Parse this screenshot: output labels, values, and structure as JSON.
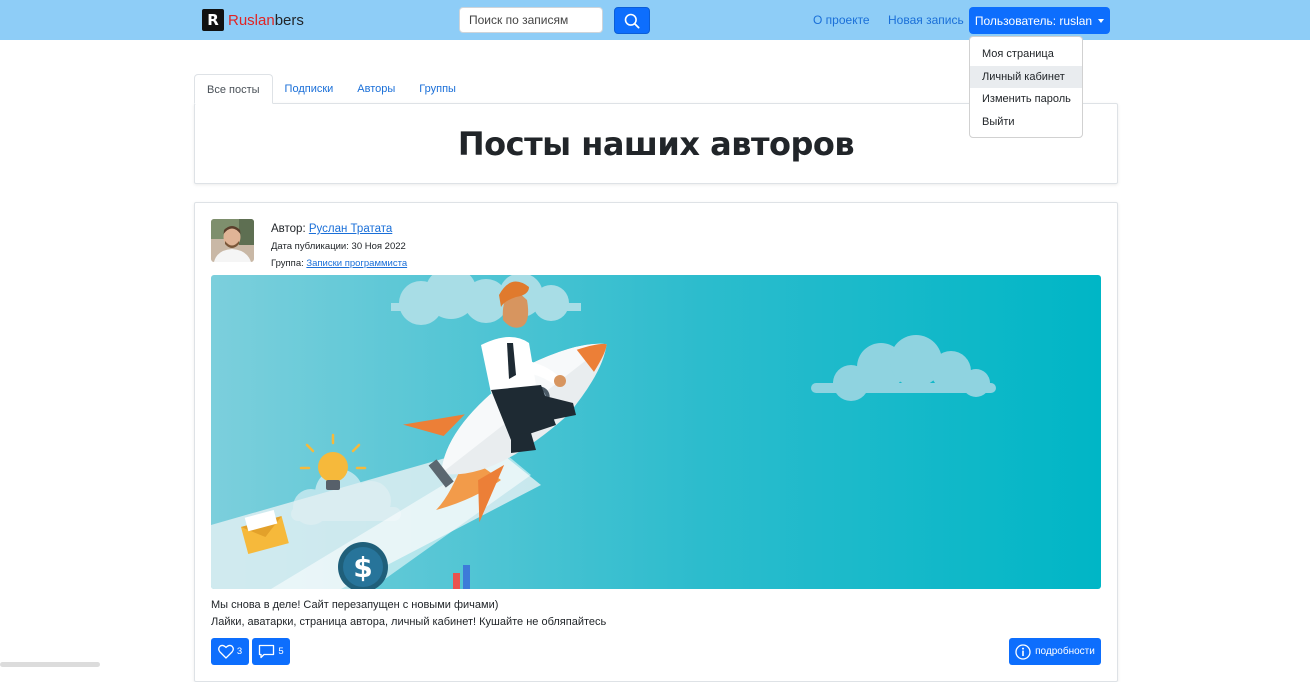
{
  "brand": {
    "logo_letter": "R",
    "name_red": "Ruslan",
    "name_rest": "bers"
  },
  "search": {
    "placeholder": "Поиск по записям",
    "value": ""
  },
  "nav": {
    "about": "О проекте",
    "new_post": "Новая запись",
    "user_button": "Пользователь: ruslan"
  },
  "user_menu": {
    "items": [
      "Моя страница",
      "Личный кабинет",
      "Изменить пароль",
      "Выйти"
    ],
    "highlighted_index": 1
  },
  "tabs": [
    "Все посты",
    "Подписки",
    "Авторы",
    "Группы"
  ],
  "page_title": "Посты наших авторов",
  "post": {
    "author_label": "Автор:",
    "author_name": "Руслан Тратата",
    "date_label": "Дата публикации:",
    "date": "30 Ноя 2022",
    "group_label": "Группа:",
    "group_name": "Записки программиста",
    "text_lines": [
      "Мы снова в деле! Сайт перезапущен с новыми фичами)",
      "Лайки, аватарки, страница автора, личный кабинет! Кушайте не обляпайтесь"
    ],
    "likes": "3",
    "comments": "5",
    "details_label": "подробности"
  },
  "colors": {
    "navbar": "#8ecdf7",
    "primary": "#0d6efd",
    "link": "#1a6fd8",
    "brand_red": "#e02424",
    "image_bg": "#12b7c6"
  },
  "icons": {
    "search": "search-icon",
    "like": "heart-icon",
    "comment": "comment-icon",
    "details": "info-icon",
    "caret": "chevron-down-icon"
  }
}
